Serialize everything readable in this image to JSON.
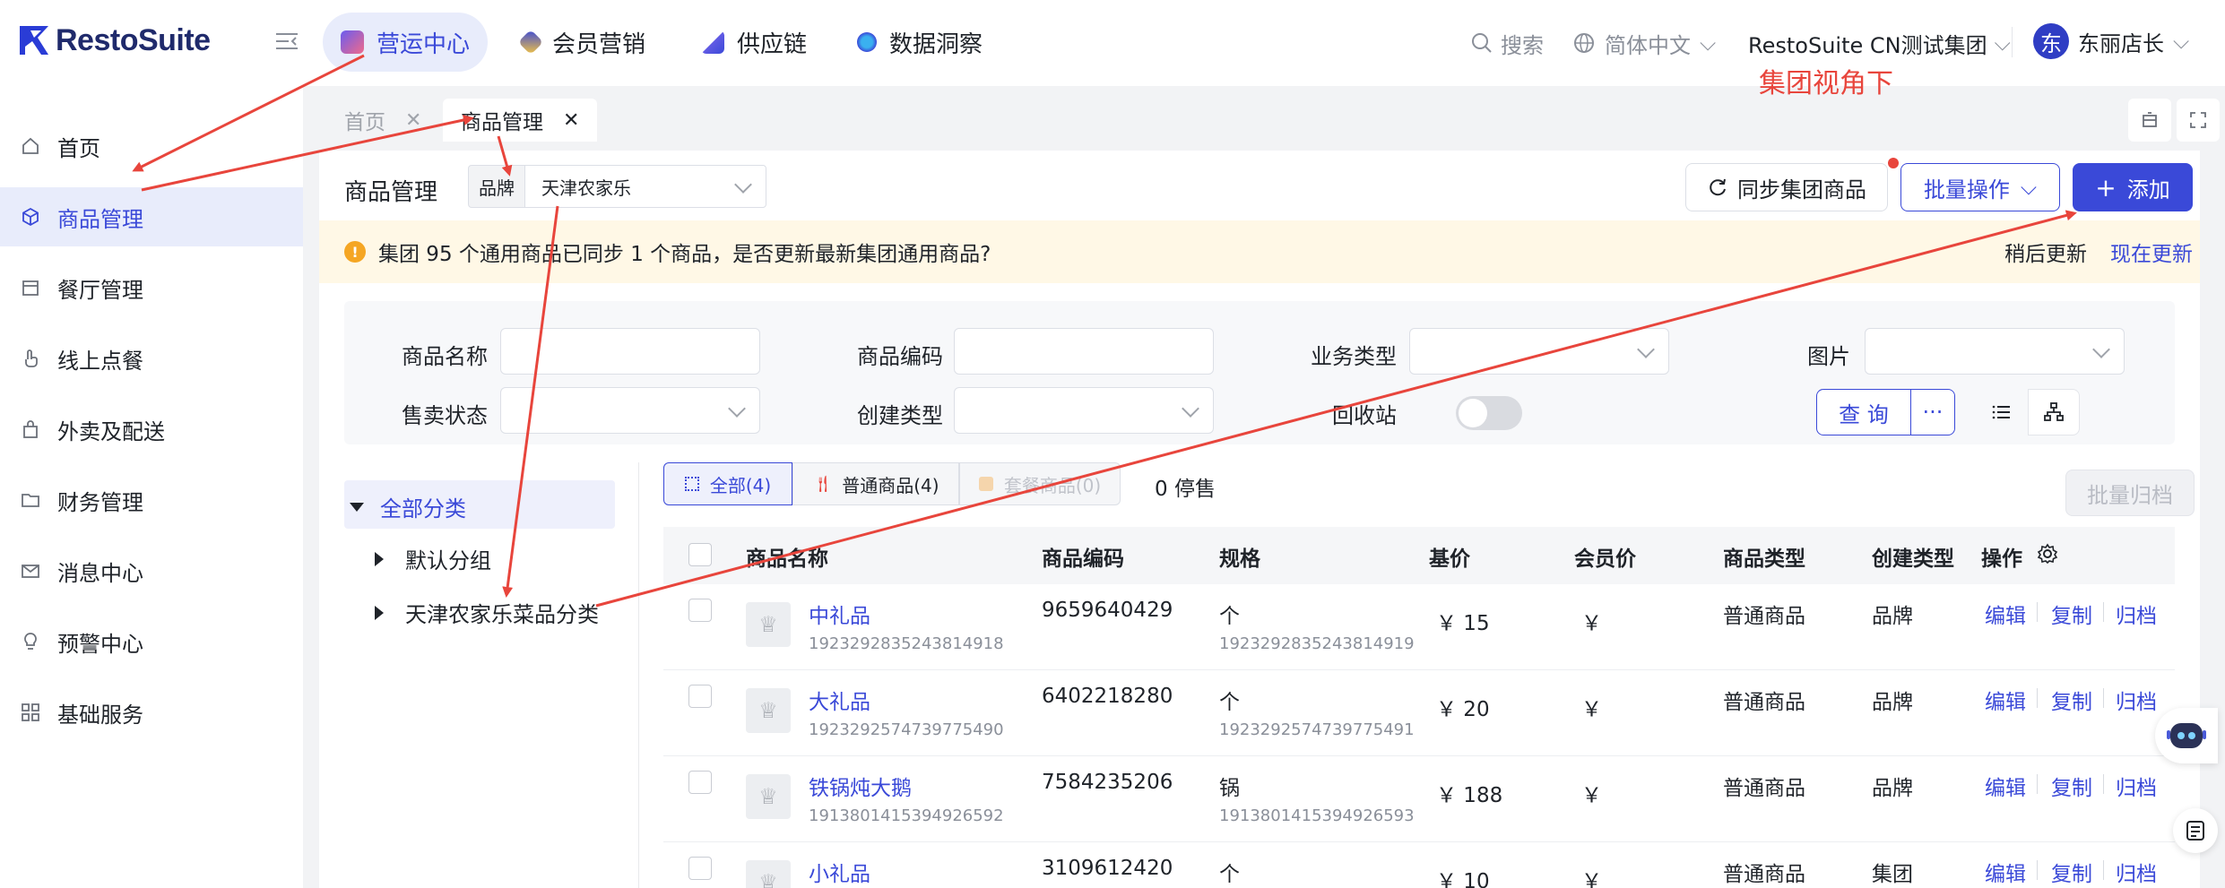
{
  "brand": {
    "name": "RestoSuite"
  },
  "topnav": {
    "tabs": [
      {
        "label": "营运中心",
        "icon": "ops-center-icon",
        "active": true
      },
      {
        "label": "会员营销",
        "icon": "member-marketing-icon"
      },
      {
        "label": "供应链",
        "icon": "supply-chain-icon"
      },
      {
        "label": "数据洞察",
        "icon": "data-insight-icon"
      }
    ],
    "search_label": "搜索",
    "language": "简体中文",
    "group": "RestoSuite CN测试集团",
    "user": {
      "avatar_text": "东",
      "name": "东丽店长"
    }
  },
  "annotation": {
    "text": "集团视角下",
    "color": "#e8453c"
  },
  "sidebar": {
    "items": [
      {
        "label": "首页",
        "icon": "home-icon"
      },
      {
        "label": "商品管理",
        "icon": "cube-icon",
        "active": true
      },
      {
        "label": "餐厅管理",
        "icon": "store-icon"
      },
      {
        "label": "线上点餐",
        "icon": "hand-tap-icon"
      },
      {
        "label": "外卖及配送",
        "icon": "bag-icon"
      },
      {
        "label": "财务管理",
        "icon": "folder-icon"
      },
      {
        "label": "消息中心",
        "icon": "mail-icon"
      },
      {
        "label": "预警中心",
        "icon": "bulb-icon"
      },
      {
        "label": "基础服务",
        "icon": "grid-icon"
      }
    ]
  },
  "page_tabs": [
    {
      "label": "首页",
      "active": false
    },
    {
      "label": "商品管理",
      "active": true
    }
  ],
  "header": {
    "title": "商品管理",
    "brand_tag": "品牌",
    "brand_value": "天津农家乐",
    "sync_button": "同步集团商品",
    "batch_button": "批量操作",
    "add_button": "添加"
  },
  "notice": {
    "text": "集团 95 个通用商品已同步 1 个商品，是否更新最新集团通用商品?",
    "later": "稍后更新",
    "now": "现在更新"
  },
  "filters": {
    "product_name": "商品名称",
    "product_code": "商品编码",
    "business_type": "业务类型",
    "image": "图片",
    "sale_status": "售卖状态",
    "create_type": "创建类型",
    "recycle_bin": "回收站",
    "query_button": "查 询",
    "more_button": "···"
  },
  "tree": {
    "all": "全部分类",
    "children": [
      "默认分组",
      "天津农家乐菜品分类"
    ]
  },
  "segments": [
    {
      "label": "全部(4)",
      "active": true
    },
    {
      "label": "普通商品(4)"
    },
    {
      "label": "套餐商品(0)",
      "disabled": true
    }
  ],
  "stop_sale": "0 停售",
  "batch_archive": "批量归档",
  "table": {
    "headers": [
      "商品名称",
      "商品编码",
      "规格",
      "基价",
      "会员价",
      "商品类型",
      "创建类型",
      "操作"
    ],
    "rows": [
      {
        "name": "中礼品",
        "id": "1923292835243814918",
        "code": "9659640429",
        "spec": "个",
        "spec_id": "1923292835243814919",
        "price": "￥ 15",
        "member_price": "￥",
        "type": "普通商品",
        "create": "品牌"
      },
      {
        "name": "大礼品",
        "id": "1923292574739775490",
        "code": "6402218280",
        "spec": "个",
        "spec_id": "1923292574739775491",
        "price": "￥ 20",
        "member_price": "￥",
        "type": "普通商品",
        "create": "品牌"
      },
      {
        "name": "铁锅炖大鹅",
        "id": "1913801415394926592",
        "code": "7584235206",
        "spec": "锅",
        "spec_id": "1913801415394926593",
        "price": "￥ 188",
        "member_price": "￥",
        "type": "普通商品",
        "create": "品牌"
      },
      {
        "name": "小礼品",
        "id": "",
        "code": "3109612420",
        "spec": "个",
        "spec_id": "",
        "price": "￥ 10",
        "member_price": "￥",
        "type": "普通商品",
        "create": "集团"
      }
    ],
    "actions": [
      "编辑",
      "复制",
      "归档"
    ]
  },
  "colors": {
    "primary": "#3a49d8",
    "annotation": "#e8453c",
    "notice_bg": "#fff8e6",
    "warning": "#f5a623"
  }
}
